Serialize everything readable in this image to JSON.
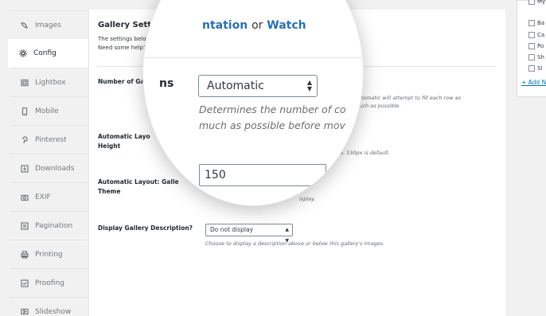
{
  "tabs": [
    {
      "label": "Images",
      "icon": "envira-leaf-icon"
    },
    {
      "label": "Config",
      "icon": "gear-icon",
      "active": true
    },
    {
      "label": "Lightbox",
      "icon": "lightbox-icon"
    },
    {
      "label": "Mobile",
      "icon": "mobile-icon"
    },
    {
      "label": "Pinterest",
      "icon": "pinterest-icon"
    },
    {
      "label": "Downloads",
      "icon": "download-icon"
    },
    {
      "label": "EXIF",
      "icon": "camera-icon"
    },
    {
      "label": "Pagination",
      "icon": "pagination-icon"
    },
    {
      "label": "Printing",
      "icon": "printer-icon"
    },
    {
      "label": "Proofing",
      "icon": "proofing-icon"
    },
    {
      "label": "Slideshow",
      "icon": "slideshow-icon"
    }
  ],
  "settings": {
    "title": "Gallery Settings",
    "intro_line1": "The settings below adj",
    "intro_line2": "Need some help?",
    "intro_link": "Re",
    "doc_link": "ntation",
    "or_text": "or",
    "watch_link": "Watch",
    "fields": {
      "columns_label": "Number of Gall",
      "columns_label_mag": "ns",
      "columns_value": "Automatic",
      "columns_desc_mag_1": "Determines the number of co",
      "columns_desc_mag_2": "much as possible before mov",
      "columns_desc_small_1": "Automatic will attempt to fill each row as",
      "columns_desc_small_2": "much as possible.",
      "height_label_1": "Automatic Layo",
      "height_label_2": "Height",
      "height_value": "150",
      "height_desc": "e. 150px is default.",
      "theme_label_1": "Automatic Layout: Galle",
      "theme_label_2": "Theme",
      "theme_desc_mag": "...",
      "theme_desc_small": "isplay.",
      "description_label": "Display Gallery Description?",
      "description_value": "Do not display",
      "description_desc": "Choose to display a description above or below this gallery's images."
    }
  },
  "sidebar_box": {
    "items": [
      "My",
      "Ba",
      "Ca",
      "Po",
      "Sh",
      "Sl"
    ],
    "add_new": "+ Add N"
  }
}
